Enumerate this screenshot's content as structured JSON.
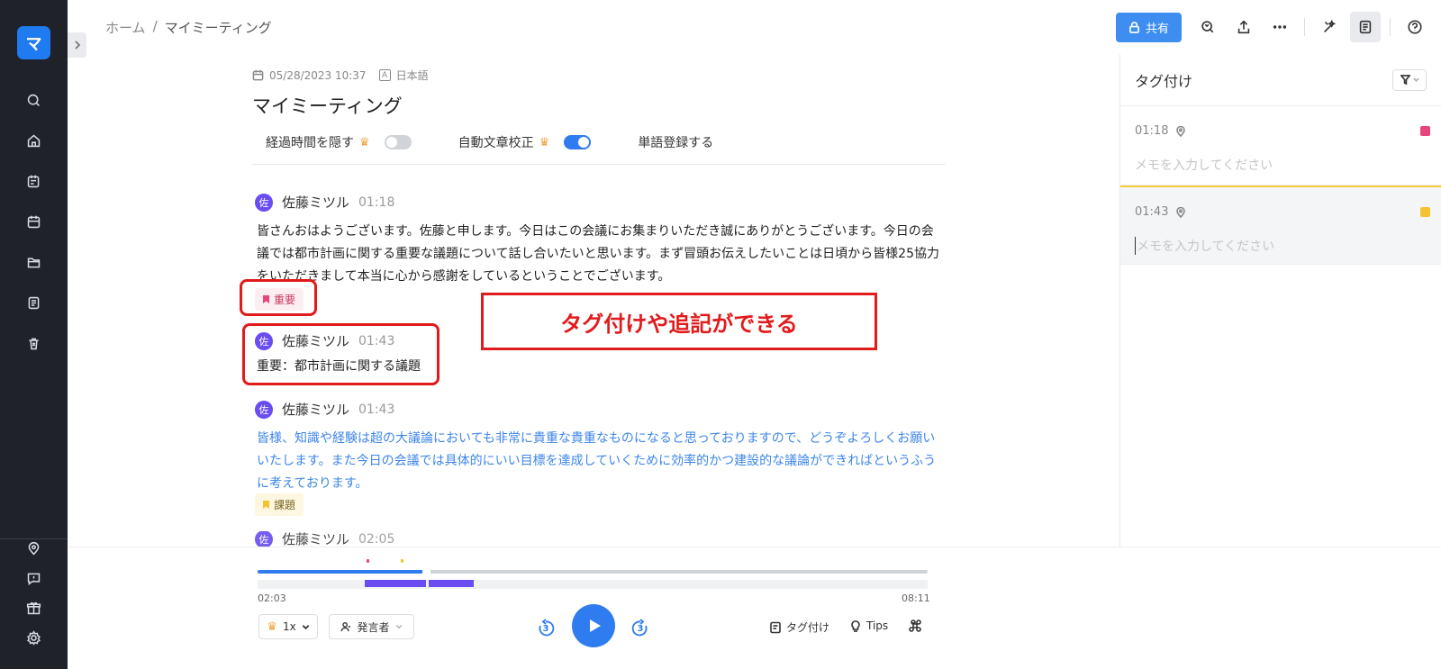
{
  "app": {
    "logo_letter": "マ"
  },
  "breadcrumb": {
    "home": "ホーム",
    "separator": "/",
    "current": "マイミーティング"
  },
  "toolbar": {
    "share_label": "共有"
  },
  "doc": {
    "date": "05/28/2023 10:37",
    "lang_icon": "A",
    "language": "日本語",
    "title": "マイミーティング",
    "options": {
      "hide_time": "経過時間を隠す",
      "auto_proofread": "自動文章校正",
      "register_words": "単語登録する",
      "hide_time_on": false,
      "auto_proofread_on": true
    }
  },
  "entries": [
    {
      "avatar": "佐",
      "speaker": "佐藤ミツル",
      "time": "01:18",
      "text": "皆さんおはようございます。佐藤と申します。今日はこの会議にお集まりいただき誠にありがとうございます。今日の会議では都市計画に関する重要な議題について話し合いたいと思います。まず冒頭お伝えしたいことは日頃から皆様25協力をいただきまして本当に心から感謝をしているということでございます。",
      "tag": "重要"
    },
    {
      "avatar": "佐",
      "speaker": "佐藤ミツル",
      "time": "01:43",
      "text": "重要：都市計画に関する議題"
    },
    {
      "avatar": "佐",
      "speaker": "佐藤ミツル",
      "time": "01:43",
      "text": "皆様、知識や経験は超の大議論においても非常に貴重な貴重なものになると思っておりますので、どうぞよろしくお願いいたします。また今日の会議では具体的にいい目標を達成していくために効率的かつ建設的な議論ができればというふうに考えております。",
      "tag": "課題"
    },
    {
      "avatar": "佐",
      "speaker": "佐藤ミツル",
      "time": "02:05"
    }
  ],
  "callout": "タグ付けや追記ができる",
  "right_panel": {
    "title": "タグ付け",
    "memos": [
      {
        "time": "01:18",
        "placeholder": "メモを入力してください",
        "color": "#e8457a"
      },
      {
        "time": "01:43",
        "placeholder": "メモを入力してください",
        "color": "#f4c430"
      }
    ]
  },
  "player": {
    "current_time": "02:03",
    "end_time": "08:11",
    "progress": 0.25,
    "speed": "1x",
    "speaker_filter": "発言者",
    "skip_back": "3",
    "skip_forward": "3",
    "tag_label": "タグ付け",
    "tips_label": "Tips"
  },
  "colors": {
    "accent": "#2f7cf0",
    "annotation_red": "#e11b1b",
    "sidebar": "#1f2329"
  }
}
